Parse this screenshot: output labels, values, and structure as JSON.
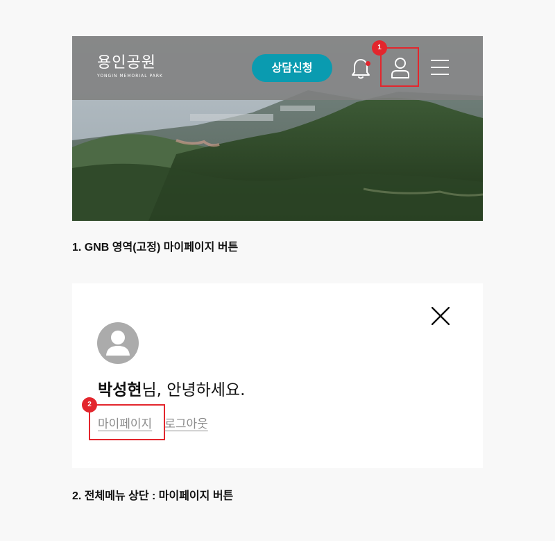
{
  "header": {
    "logo_main": "용인공원",
    "logo_sub": "YONGIN MEMORIAL PARK",
    "consult_label": "상담신청"
  },
  "annotations": {
    "badge_1": "1",
    "badge_2": "2",
    "caption_1": "1. GNB 영역(고정) 마이페이지 버튼",
    "caption_2": "2.  전체메뉴 상단 : 마이페이지 버튼"
  },
  "menu": {
    "user_name": "박성현",
    "greeting_suffix": "님, 안녕하세요.",
    "mypage_label": "마이페이지",
    "logout_label": "로그아웃"
  },
  "colors": {
    "accent": "#0a9bb0",
    "highlight": "#e3262d",
    "gnb_overlay": "#808080"
  },
  "icons": [
    "bell-icon",
    "user-icon",
    "hamburger-menu-icon",
    "close-icon",
    "avatar-icon"
  ]
}
